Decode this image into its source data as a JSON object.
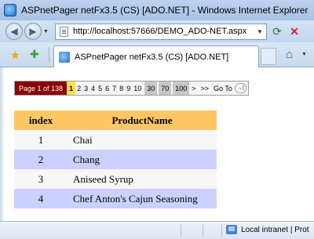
{
  "window": {
    "title": "ASPnetPager netFx3.5 (CS) [ADO.NET] - Windows Internet Explorer"
  },
  "toolbar": {
    "url": "http://localhost:57666/DEMO_ADO-NET.aspx",
    "tab_title": "ASPnetPager netFx3.5 (CS) [ADO.NET]"
  },
  "pager": {
    "info": "Page 1 of 138",
    "current_page": "1",
    "pages": [
      "2",
      "3",
      "4",
      "5",
      "6",
      "7",
      "8",
      "9",
      "10"
    ],
    "jumps": [
      "30",
      "70",
      "100"
    ],
    "next": ">",
    "last": ">>",
    "goto_label": "Go To"
  },
  "grid": {
    "headers": [
      "index",
      "ProductName"
    ],
    "rows": [
      {
        "index": "1",
        "name": "Chai"
      },
      {
        "index": "2",
        "name": "Chang"
      },
      {
        "index": "3",
        "name": "Aniseed Syrup"
      },
      {
        "index": "4",
        "name": "Chef Anton's Cajun Seasoning"
      }
    ]
  },
  "status": {
    "zone": "Local intranet | Prot"
  },
  "colors": {
    "pager_info_bg": "#8b0000",
    "current_page_bg": "#ffe14a",
    "header_bg": "#ffc763",
    "alt_row_bg": "#ccd0fe"
  }
}
